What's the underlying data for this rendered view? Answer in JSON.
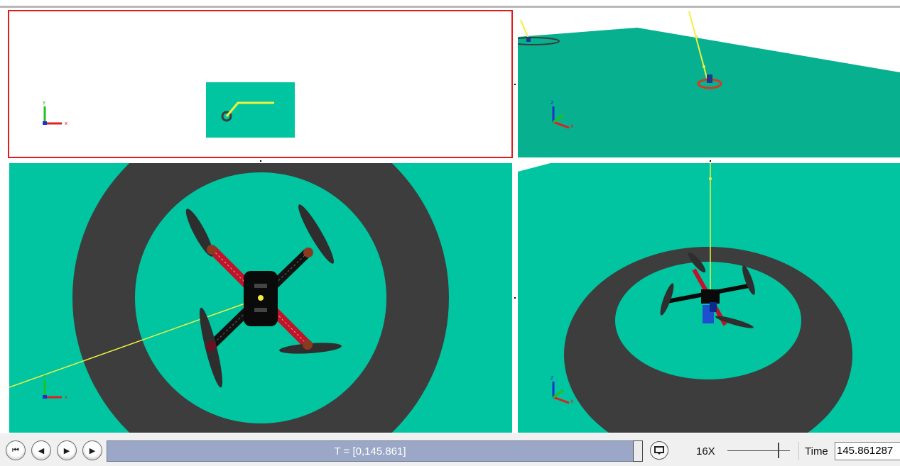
{
  "playback": {
    "rewind_label": "⏮",
    "step_back_label": "◀",
    "play_label": "▶",
    "step_forward_label": "▶",
    "time_range_text": "T = [0,145.861]",
    "speed_text": "16X",
    "time_label": "Time",
    "time_value": "145.861287"
  },
  "axes": {
    "x": "x",
    "y": "y",
    "z": "z"
  },
  "colors": {
    "ground": "#00c5a0",
    "ground_far": "#07b08f",
    "pad_ring": "#3d3d3d",
    "trajectory": "#f0f040",
    "selected_border": "#e01b1b",
    "timebar": "#9aa7c6"
  },
  "icons": {
    "rewind": "rewind-icon",
    "step_back": "step-back-icon",
    "play": "play-icon",
    "step_forward": "step-forward-icon",
    "loop": "loop-icon"
  }
}
